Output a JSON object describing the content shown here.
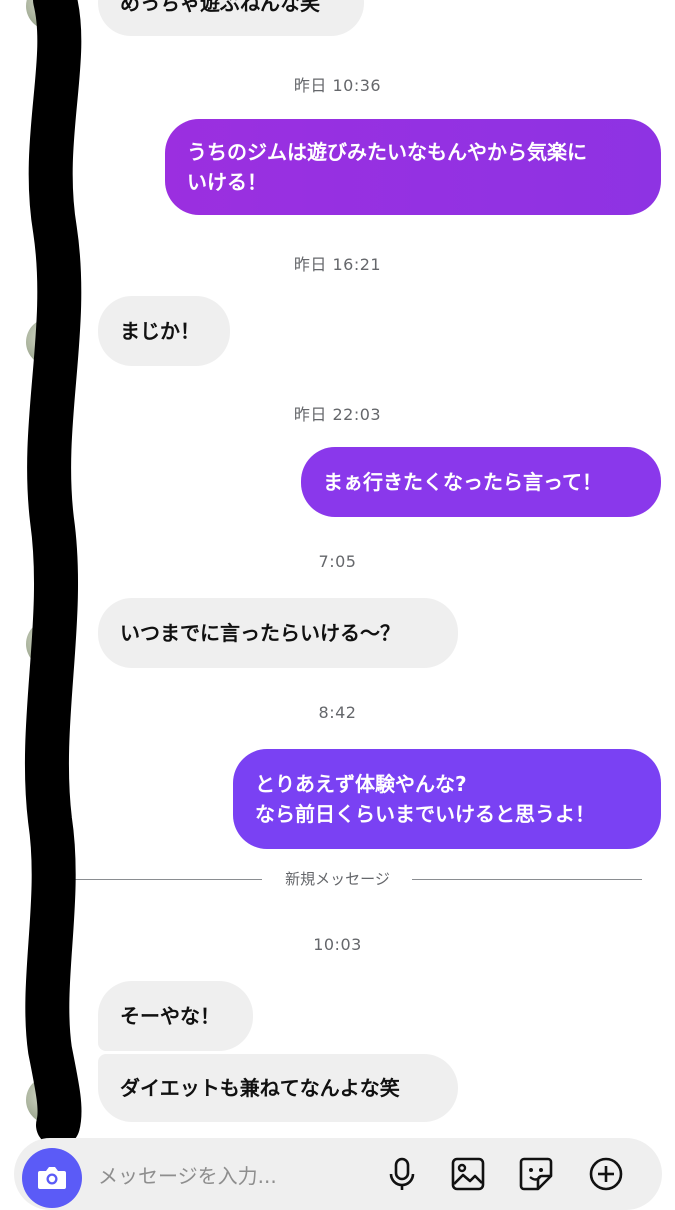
{
  "messages": {
    "top_partial": "めっちゃ遊ぶねんな笑",
    "ts1": "昨日 10:36",
    "out1": "うちのジムは遊びみたいなもんやから気楽に",
    "out1_line2": "いける！",
    "ts2": "昨日 16:21",
    "in1": "まじか！",
    "ts3": "昨日 22:03",
    "out2": "まぁ行きたくなったら言って！",
    "ts4": "7:05",
    "in2": "いつまでに言ったらいける〜？",
    "ts5": "8:42",
    "out3_line1": "とりあえず体験やんな?",
    "out3_line2": "なら前日くらいまでいけると思うよ！",
    "new_messages_label": "新規メッセージ",
    "ts6": "10:03",
    "in3": "そーやな！",
    "in4": "ダイエットも兼ねてなんよな笑"
  },
  "composer": {
    "placeholder": "メッセージを入力...",
    "icons": [
      "camera-icon",
      "microphone-icon",
      "image-icon",
      "sticker-icon",
      "plus-icon"
    ]
  },
  "colors": {
    "outgoing_top": "#9b2fe0",
    "outgoing_mid": "#8a38eb",
    "outgoing_bottom": "#7a41f3",
    "incoming": "#efefef",
    "camera_button": "#5b5bf7"
  }
}
